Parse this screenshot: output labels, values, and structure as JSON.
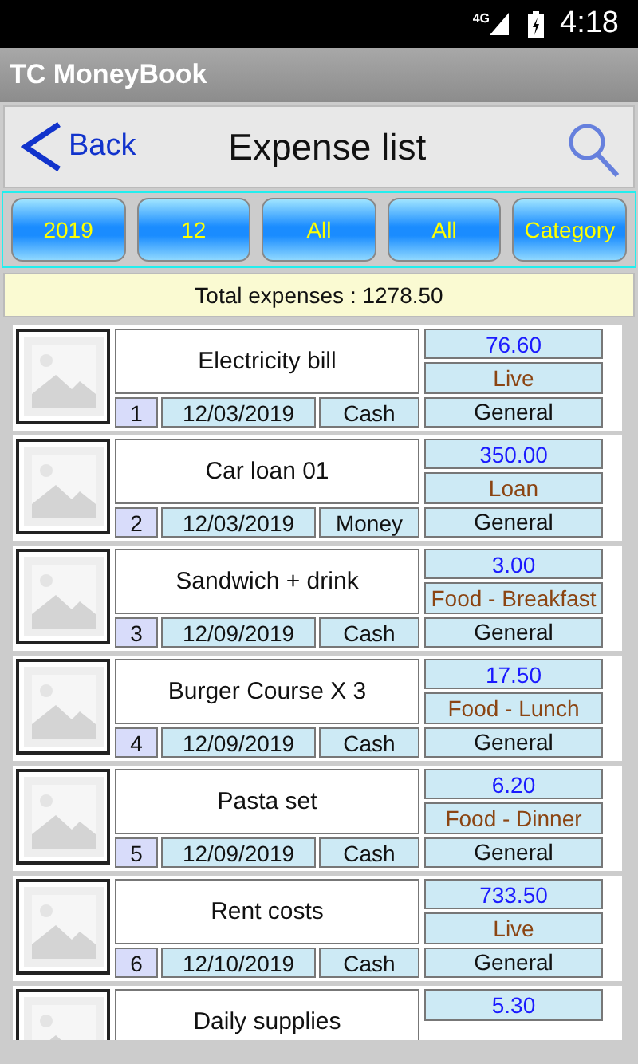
{
  "status_bar": {
    "network": "4G",
    "time": "4:18"
  },
  "app_title": "TC MoneyBook",
  "header": {
    "back": "Back",
    "title": "Expense list"
  },
  "filters": [
    {
      "label": "2019"
    },
    {
      "label": "12"
    },
    {
      "label": "All"
    },
    {
      "label": "All"
    },
    {
      "label": "Category"
    }
  ],
  "total": "Total expenses : 1278.50",
  "expenses": [
    {
      "title": "Electricity bill",
      "number": "1",
      "date": "12/03/2019",
      "payment": "Cash",
      "amount": "76.60",
      "category": "Live",
      "group": "General"
    },
    {
      "title": "Car loan 01",
      "number": "2",
      "date": "12/03/2019",
      "payment": "Money",
      "amount": "350.00",
      "category": "Loan",
      "group": "General"
    },
    {
      "title": "Sandwich + drink",
      "number": "3",
      "date": "12/09/2019",
      "payment": "Cash",
      "amount": "3.00",
      "category": "Food - Breakfast",
      "group": "General"
    },
    {
      "title": "Burger Course X 3",
      "number": "4",
      "date": "12/09/2019",
      "payment": "Cash",
      "amount": "17.50",
      "category": "Food - Lunch",
      "group": "General"
    },
    {
      "title": "Pasta set",
      "number": "5",
      "date": "12/09/2019",
      "payment": "Cash",
      "amount": "6.20",
      "category": "Food - Dinner",
      "group": "General"
    },
    {
      "title": "Rent costs",
      "number": "6",
      "date": "12/10/2019",
      "payment": "Cash",
      "amount": "733.50",
      "category": "Live",
      "group": "General"
    },
    {
      "title": "Daily supplies",
      "amount": "5.30"
    }
  ]
}
